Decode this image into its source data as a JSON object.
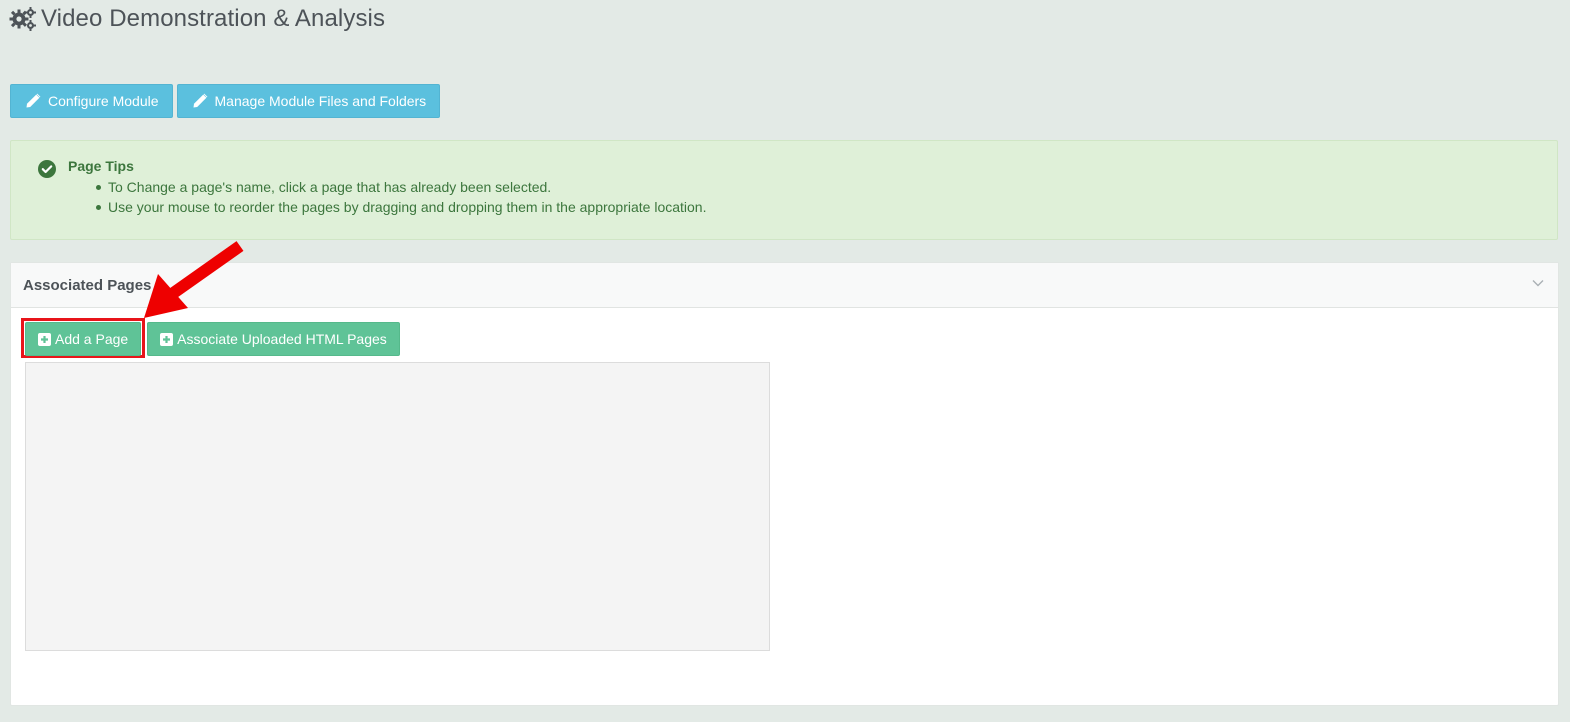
{
  "header": {
    "title": "Video Demonstration & Analysis",
    "icon": "gears-icon"
  },
  "toolbar": {
    "configure_label": "Configure Module",
    "manage_label": "Manage Module Files and Folders",
    "button_icon": "pencil-icon",
    "button_color": "#5bc0de"
  },
  "tips": {
    "title": "Page Tips",
    "icon": "check-circle-icon",
    "items": [
      "To Change a page's name, click a page that has already been selected.",
      "Use your mouse to reorder the pages by dragging and dropping them in the appropriate location."
    ],
    "color": "#3c763d",
    "background": "#dff0d8"
  },
  "panel": {
    "title": "Associated Pages",
    "add_page_label": "Add a Page",
    "associate_label": "Associate Uploaded HTML Pages",
    "button_color": "#5fc397",
    "highlight_color": "#e8141a"
  }
}
